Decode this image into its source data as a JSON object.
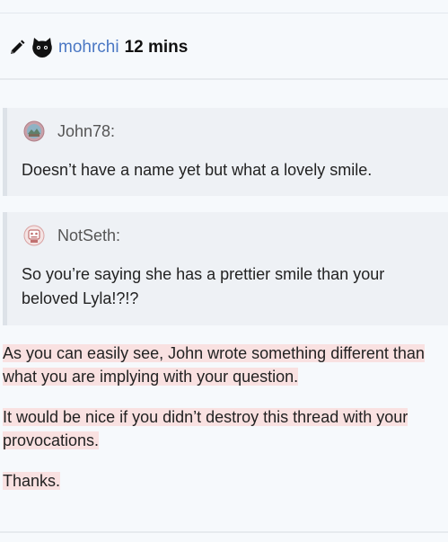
{
  "post": {
    "author": "mohrchi",
    "time": "12 mins",
    "icons": [
      "pencil-icon",
      "cat-avatar"
    ]
  },
  "quotes": [
    {
      "author": "John78:",
      "text": "Doesn’t have a name yet but what a lovely smile.",
      "avatar_icon": "landscape-avatar"
    },
    {
      "author": "NotSeth:",
      "text": "So you’re saying she has a prettier smile than your beloved Lyla!?!?",
      "avatar_icon": "robot-avatar"
    }
  ],
  "body": {
    "paragraphs": [
      "As you can easily see, John wrote something different than what you are implying with your question.",
      "It would be nice if you didn’t destroy this thread with your provocations.",
      "Thanks."
    ]
  },
  "colors": {
    "background": "#f6f9fc",
    "username": "#4b78c4",
    "quote_bg": "#eef1f5",
    "quote_border": "#dde2e8",
    "highlight": "#f9e1e1"
  }
}
